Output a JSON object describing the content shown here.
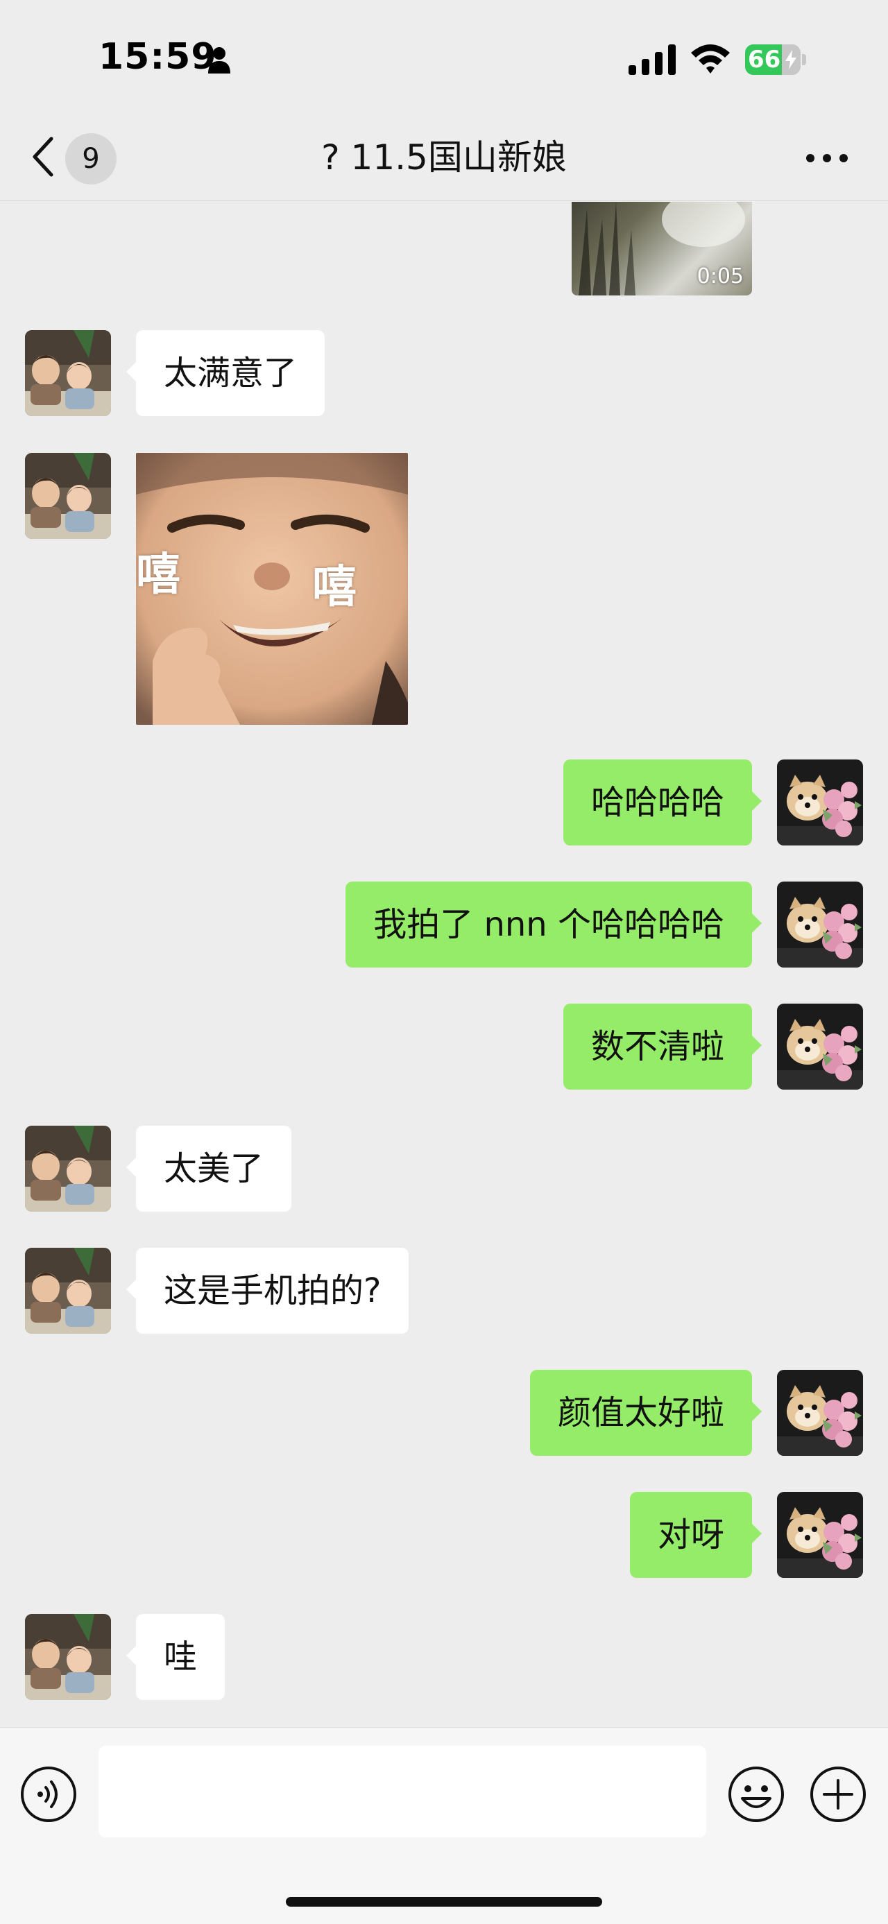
{
  "status_bar": {
    "time": "15:59",
    "battery_level": "66",
    "battery_fraction": 0.66,
    "icons": [
      "person-icon",
      "signal-icon",
      "wifi-icon",
      "battery-icon"
    ]
  },
  "nav": {
    "back_icon": "chevron-left-icon",
    "unread_count": "9",
    "title": "? 11.5国山新娘",
    "more_icon": "more-dots-icon"
  },
  "colors": {
    "background": "#ededed",
    "incoming_bubble": "#ffffff",
    "outgoing_bubble": "#95ec69",
    "battery_green": "#34c759"
  },
  "messages": [
    {
      "type": "video",
      "direction": "outgoing",
      "duration": "0:05"
    },
    {
      "type": "text",
      "direction": "incoming",
      "text": "太满意了"
    },
    {
      "type": "sticker",
      "direction": "incoming",
      "caption_left": "嘻",
      "caption_right": "嘻"
    },
    {
      "type": "text",
      "direction": "outgoing",
      "text": "哈哈哈哈"
    },
    {
      "type": "text",
      "direction": "outgoing",
      "text": "我拍了 nnn 个哈哈哈哈"
    },
    {
      "type": "text",
      "direction": "outgoing",
      "text": "数不清啦"
    },
    {
      "type": "text",
      "direction": "incoming",
      "text": "太美了"
    },
    {
      "type": "text",
      "direction": "incoming",
      "text": "这是手机拍的?"
    },
    {
      "type": "text",
      "direction": "outgoing",
      "text": "颜值太好啦"
    },
    {
      "type": "text",
      "direction": "outgoing",
      "text": "对呀"
    },
    {
      "type": "text",
      "direction": "incoming",
      "text": "哇"
    }
  ],
  "input_bar": {
    "placeholder": "",
    "value": "",
    "icons": [
      "voice-icon",
      "emoji-icon",
      "plus-icon"
    ]
  }
}
